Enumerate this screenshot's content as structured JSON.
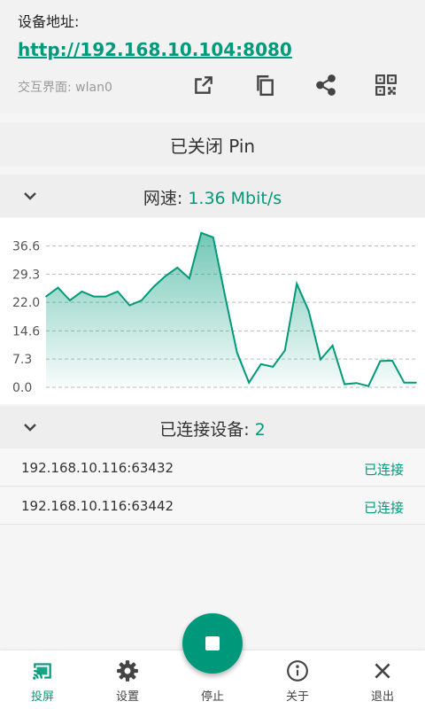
{
  "address": {
    "title": "设备地址:",
    "url": "http://192.168.10.104:8080",
    "interface": "交互界面: wlan0",
    "actions": [
      "open-external-icon",
      "copy-icon",
      "share-icon",
      "qr-code-icon"
    ]
  },
  "pin": {
    "status": "已关闭 Pin"
  },
  "speed": {
    "label": "网速: ",
    "value": "1.36 Mbit/s"
  },
  "chart_data": {
    "type": "area",
    "y_ticks": [
      "36.6",
      "29.3",
      "22.0",
      "14.6",
      "7.3",
      "0.0"
    ],
    "ylim": [
      0,
      40
    ],
    "grid": true,
    "values": [
      23.5,
      25.8,
      22.5,
      24.8,
      23.5,
      23.5,
      24.8,
      21.2,
      22.5,
      26,
      28.8,
      31,
      28.2,
      40,
      38.8,
      23.5,
      9,
      1.2,
      6,
      5.3,
      9.5,
      26.8,
      19.8,
      7.2,
      10.8,
      0.8,
      1.1,
      0.3,
      6.8,
      6.9,
      1.2,
      1.2
    ],
    "line_color": "#009a7a"
  },
  "connections": {
    "label": "已连接设备: ",
    "count": "2",
    "items": [
      {
        "ip": "192.168.10.116:63432",
        "status": "已连接"
      },
      {
        "ip": "192.168.10.116:63442",
        "status": "已连接"
      }
    ]
  },
  "nav": {
    "items": [
      {
        "label": "投屏",
        "icon": "cast-icon"
      },
      {
        "label": "设置",
        "icon": "gear-icon"
      },
      {
        "label": "停止",
        "icon": "stop-icon"
      },
      {
        "label": "关于",
        "icon": "info-icon"
      },
      {
        "label": "退出",
        "icon": "close-icon"
      }
    ]
  },
  "colors": {
    "accent": "#009a7a",
    "fab": "#00987a"
  }
}
